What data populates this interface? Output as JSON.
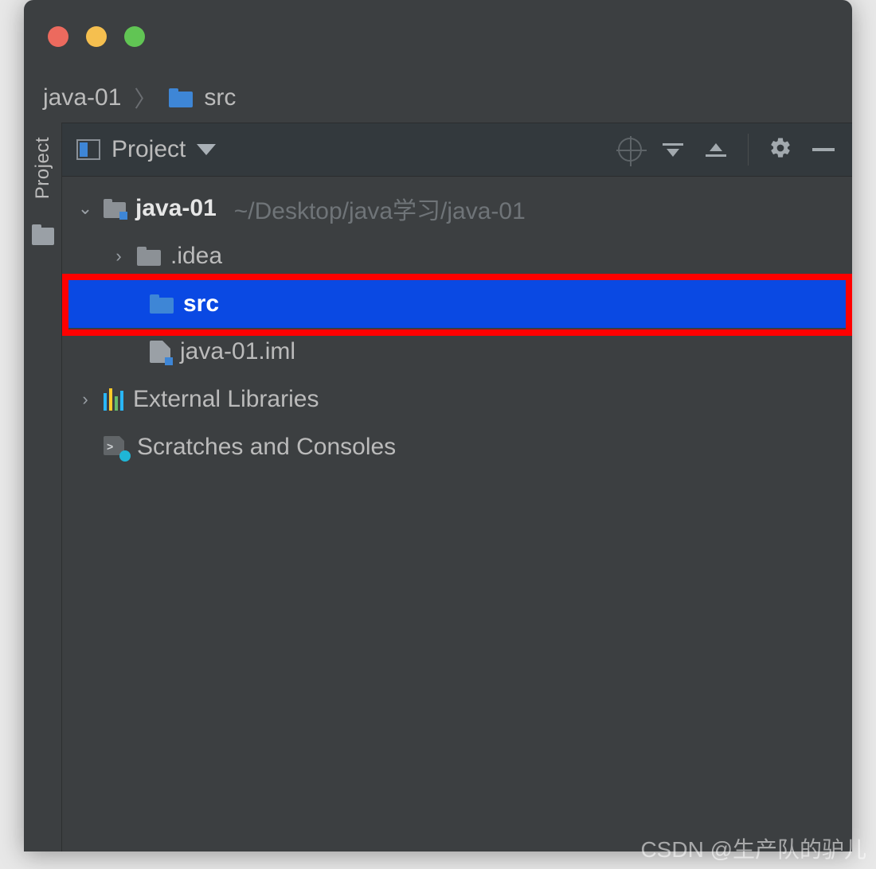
{
  "breadcrumb": {
    "root": "java-01",
    "folder": "src"
  },
  "toolwindow": {
    "title": "Project",
    "sidebar_label": "Project"
  },
  "tree": {
    "project_name": "java-01",
    "project_path": "~/Desktop/java学习/java-01",
    "idea_folder": ".idea",
    "src_folder": "src",
    "iml_file": "java-01.iml",
    "external_libs": "External Libraries",
    "scratches": "Scratches and Consoles"
  },
  "watermark": "CSDN @生产队的驴儿",
  "icons": {
    "folder": "folder-icon",
    "module": "module-folder-icon",
    "libraries": "libraries-icon",
    "scratches": "scratches-icon",
    "iml": "iml-file-icon",
    "target": "show-target-icon",
    "expand": "expand-all-icon",
    "collapse": "collapse-all-icon",
    "gear": "gear-icon",
    "hide": "hide-icon"
  }
}
